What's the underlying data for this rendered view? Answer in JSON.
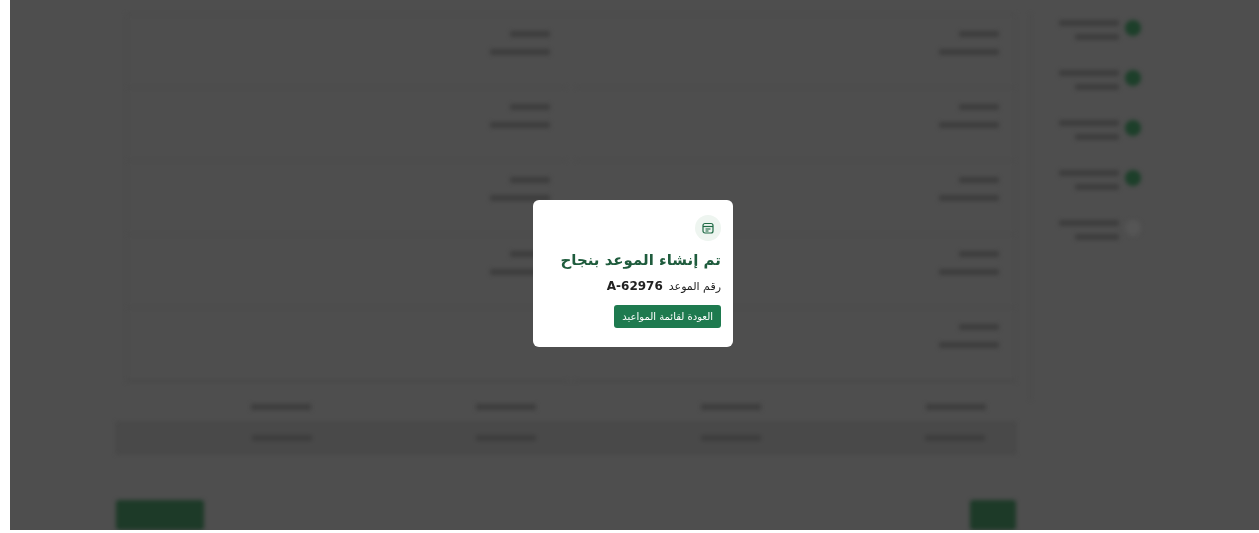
{
  "dialog": {
    "title": "تم إنشاء الموعد بنجاح",
    "number_label": "رقم الموعد",
    "number": "A-62976",
    "button": "العودة لقائمة المواعيد"
  }
}
